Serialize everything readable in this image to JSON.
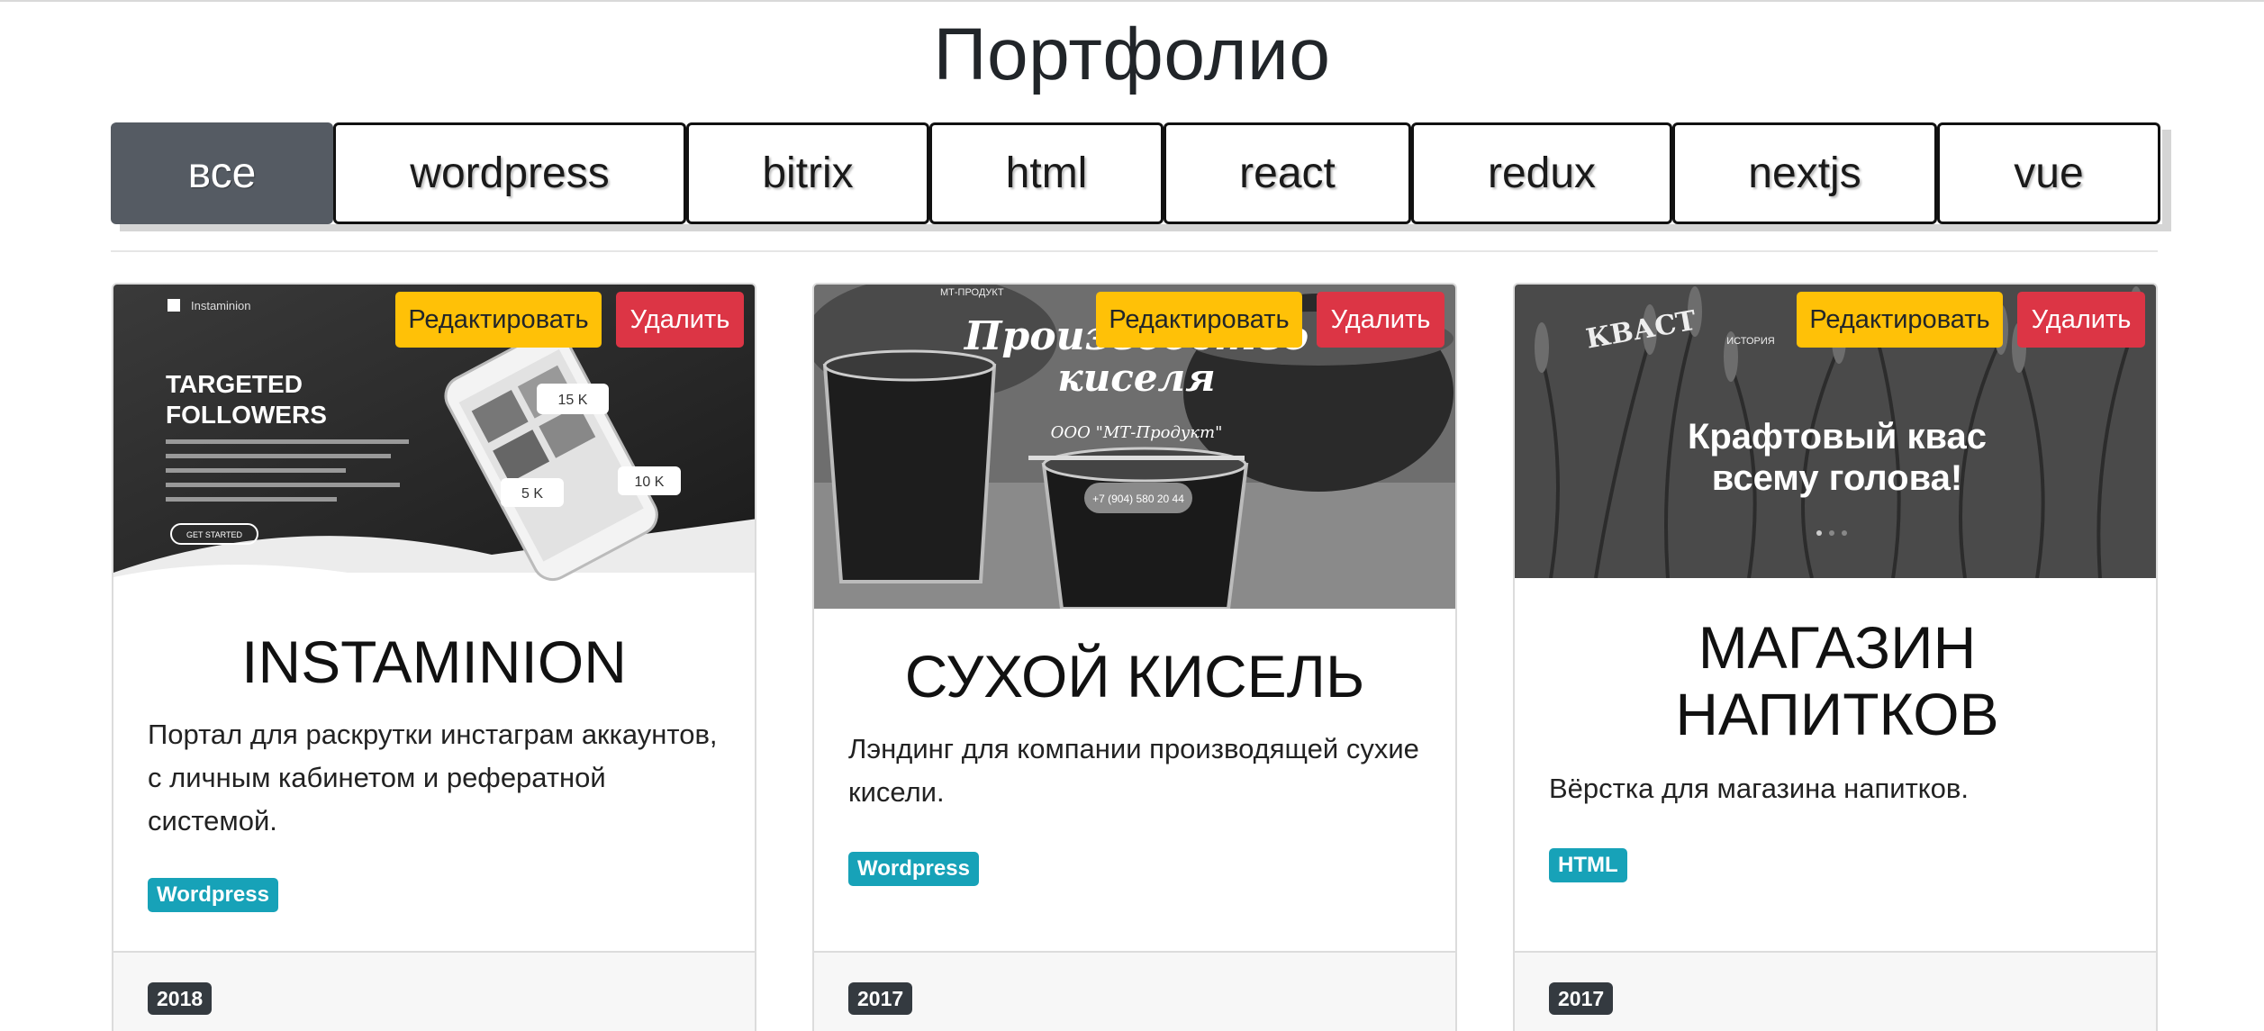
{
  "page": {
    "title": "Портфолио"
  },
  "filters": [
    {
      "label": "все",
      "active": true
    },
    {
      "label": "wordpress"
    },
    {
      "label": "bitrix"
    },
    {
      "label": "html"
    },
    {
      "label": "react"
    },
    {
      "label": "redux"
    },
    {
      "label": "nextjs"
    },
    {
      "label": "vue"
    }
  ],
  "actions": {
    "edit_label": "Редактировать",
    "delete_label": "Удалить"
  },
  "cards": [
    {
      "title": "INSTAMINION",
      "description": "Портал для раскрутки инстаграм аккаунтов, с личным кабинетом и рефератной системой.",
      "tag": "Wordpress",
      "year": "2018",
      "image": {
        "brand": "Instaminion",
        "heading_line1": "TARGETED",
        "heading_line2": "FOLLOWERS",
        "cta": "GET STARTED",
        "badge1": "15 K",
        "badge2": "5 K",
        "badge3": "10 K"
      }
    },
    {
      "title": "СУХОЙ КИСЕЛЬ",
      "description": "Лэндинг для компании производящей сухие кисели.",
      "tag": "Wordpress",
      "year": "2017",
      "image": {
        "brand": "МТ-ПРОДУКТ",
        "heading_line1": "Производство",
        "heading_line2": "киселя",
        "company": "ООО \"МТ-Продукт\"",
        "phone": "+7 (904) 580 20 44"
      }
    },
    {
      "title": "МАГАЗИН НАПИТКОВ",
      "description": "Вёрстка для магазина напитков.",
      "tag": "HTML",
      "year": "2017",
      "image": {
        "brand": "КВАСТ",
        "menu": "ИСТОРИЯ",
        "heading_line1": "Крафтовый квас",
        "heading_line2": "всему голова!"
      }
    }
  ]
}
